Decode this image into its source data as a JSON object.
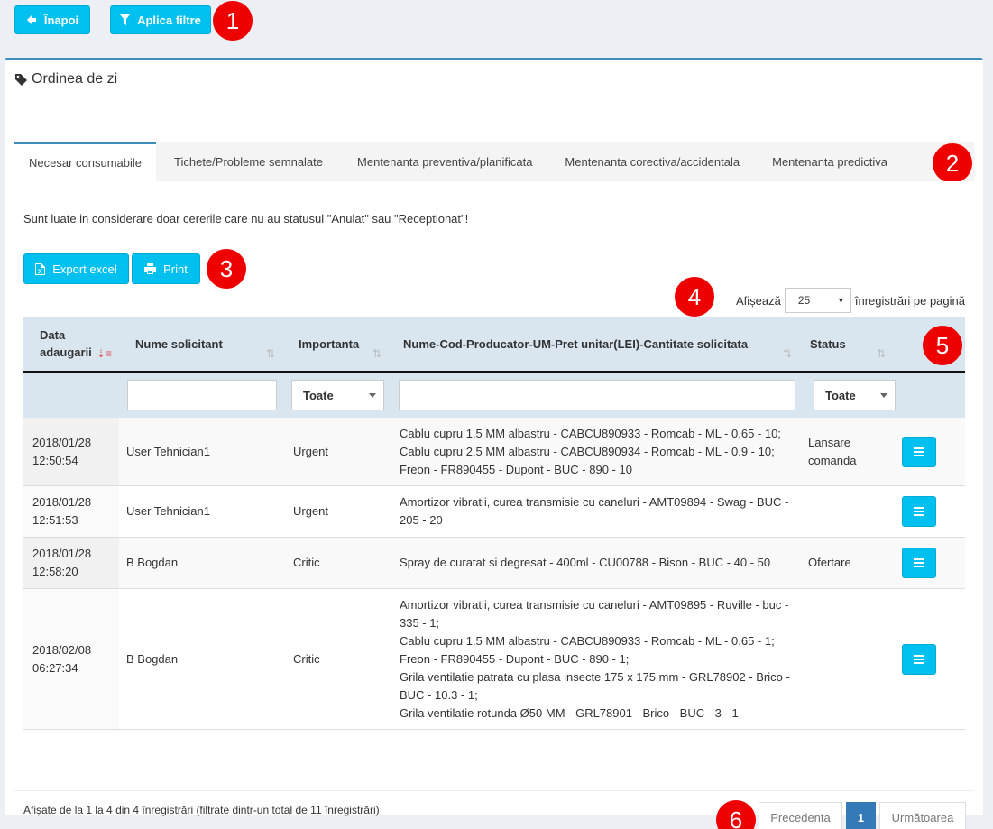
{
  "toolbar": {
    "back_label": "Înapoi",
    "filter_label": "Aplica filtre"
  },
  "box": {
    "title": "Ordinea de zi"
  },
  "tabs": [
    {
      "label": "Necesar consumabile"
    },
    {
      "label": "Tichete/Probleme semnalate"
    },
    {
      "label": "Mentenanta preventiva/planificata"
    },
    {
      "label": "Mentenanta corectiva/accidentala"
    },
    {
      "label": "Mentenanta predictiva"
    }
  ],
  "notice": "Sunt luate in considerare doar cererile care nu au statusul \"Anulat\" sau \"Receptionat\"!",
  "actions": {
    "export_label": "Export excel",
    "print_label": "Print"
  },
  "length": {
    "prefix": "Afișează",
    "value": "25",
    "suffix": "înregistrări pe pagină"
  },
  "table": {
    "headers": [
      "Data adaugarii",
      "Nume solicitant",
      "Importanta",
      "Nume-Cod-Producator-UM-Pret unitar(LEI)-Cantitate solicitata",
      "Status"
    ],
    "filters": {
      "importanta": "Toate",
      "status": "Toate"
    },
    "rows": [
      {
        "date": "2018/01/28",
        "time": "12:50:54",
        "name": "User Tehnician1",
        "importance": "Urgent",
        "items": [
          "Cablu cupru 1.5 MM albastru - CABCU890933 - Romcab - ML - 0.65 - 10;",
          "Cablu cupru 2.5 MM albastru - CABCU890934 - Romcab - ML - 0.9 - 10;",
          "Freon - FR890455 - Dupont - BUC - 890 - 10"
        ],
        "status": [
          "Lansare",
          "comanda"
        ]
      },
      {
        "date": "2018/01/28",
        "time": "12:51:53",
        "name": "User Tehnician1",
        "importance": "Urgent",
        "items": [
          "Amortizor vibratii, curea transmisie cu caneluri - AMT09894 - Swag - BUC -",
          "205 - 20"
        ],
        "status": []
      },
      {
        "date": "2018/01/28",
        "time": "12:58:20",
        "name": "B Bogdan",
        "importance": "Critic",
        "items": [
          "Spray de curatat si degresat - 400ml - CU00788 - Bison - BUC - 40 - 50"
        ],
        "status": [
          "Ofertare"
        ]
      },
      {
        "date": "2018/02/08",
        "time": "06:27:34",
        "name": "B Bogdan",
        "importance": "Critic",
        "items": [
          "Amortizor vibratii, curea transmisie cu caneluri - AMT09895 - Ruville - buc -",
          "335 - 1;",
          "Cablu cupru 1.5 MM albastru - CABCU890933 - Romcab - ML - 0.65 - 1;",
          "Freon - FR890455 - Dupont - BUC - 890 - 1;",
          "Grila ventilatie patrata cu plasa insecte 175 x 175 mm - GRL78902 - Brico -",
          "BUC - 10.3 - 1;",
          "Grila ventilatie rotunda Ø50 MM - GRL78901 - Brico - BUC - 3 - 1"
        ],
        "status": []
      }
    ]
  },
  "info": "Afișate de la 1 la 4 din 4 înregistrări (filtrate dintr-un total de 11 înregistrări)",
  "pager": {
    "prev": "Precedenta",
    "current": "1",
    "next": "Următoarea"
  },
  "badges": [
    "1",
    "2",
    "3",
    "4",
    "5",
    "6"
  ],
  "colors": {
    "accent": "#00c0ef",
    "primary": "#3c8dbc",
    "badge": "#ee0000"
  }
}
